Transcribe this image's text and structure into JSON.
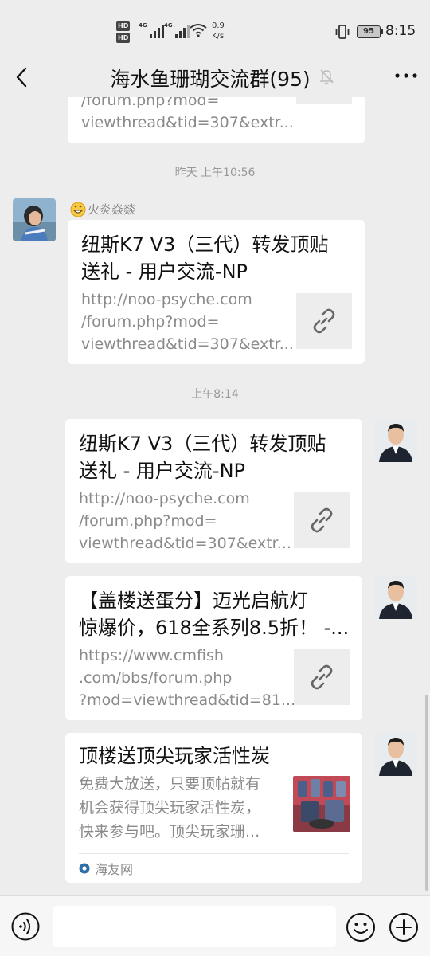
{
  "status_bar": {
    "hd1": "HD",
    "hd2": "HD",
    "net1": "4G",
    "net2": "4G",
    "speed_value": "0.9",
    "speed_unit": "K/s",
    "battery": "95",
    "time": "8:15"
  },
  "header": {
    "title": "海水鱼珊瑚交流群(95)"
  },
  "messages": [
    {
      "title": "",
      "desc_lines": [
        "/forum.php?mod=",
        "viewthread&tid=307&extr..."
      ]
    },
    {
      "time": "昨天 上午10:56",
      "sender": "火炎焱燚",
      "title_lines": [
        "纽斯K7 V3（三代）转发顶贴",
        "送礼 - 用户交流-NP"
      ],
      "desc_lines": [
        "http://noo-psyche.com",
        "/forum.php?mod=",
        "viewthread&tid=307&extr..."
      ]
    },
    {
      "time": "上午8:14",
      "title_lines": [
        "纽斯K7 V3（三代）转发顶贴",
        "送礼 - 用户交流-NP"
      ],
      "desc_lines": [
        "http://noo-psyche.com",
        "/forum.php?mod=",
        "viewthread&tid=307&extr..."
      ]
    },
    {
      "title_lines": [
        "【盖楼送蛋分】迈光启航灯",
        "惊爆价，618全系列8.5折！ -..."
      ],
      "desc_lines": [
        "https://www.cmfish",
        ".com/bbs/forum.php",
        "?mod=viewthread&tid=81..."
      ]
    },
    {
      "title_lines": [
        "顶楼送顶尖玩家活性炭"
      ],
      "desc_lines": [
        "免费大放送，只要顶帖就有",
        "机会获得顶尖玩家活性炭，",
        "快来参与吧。顶尖玩家珊..."
      ],
      "source": "海友网"
    }
  ],
  "icons": {
    "back": "chevron-left-icon",
    "mute": "bell-off-icon",
    "more": "more-icon",
    "link": "link-icon",
    "voice": "voice-icon",
    "emoji": "smile-icon",
    "plus": "plus-icon"
  },
  "colors": {
    "background": "#ededed",
    "bubble": "#ffffff",
    "muted_text": "#8a8a8a"
  }
}
